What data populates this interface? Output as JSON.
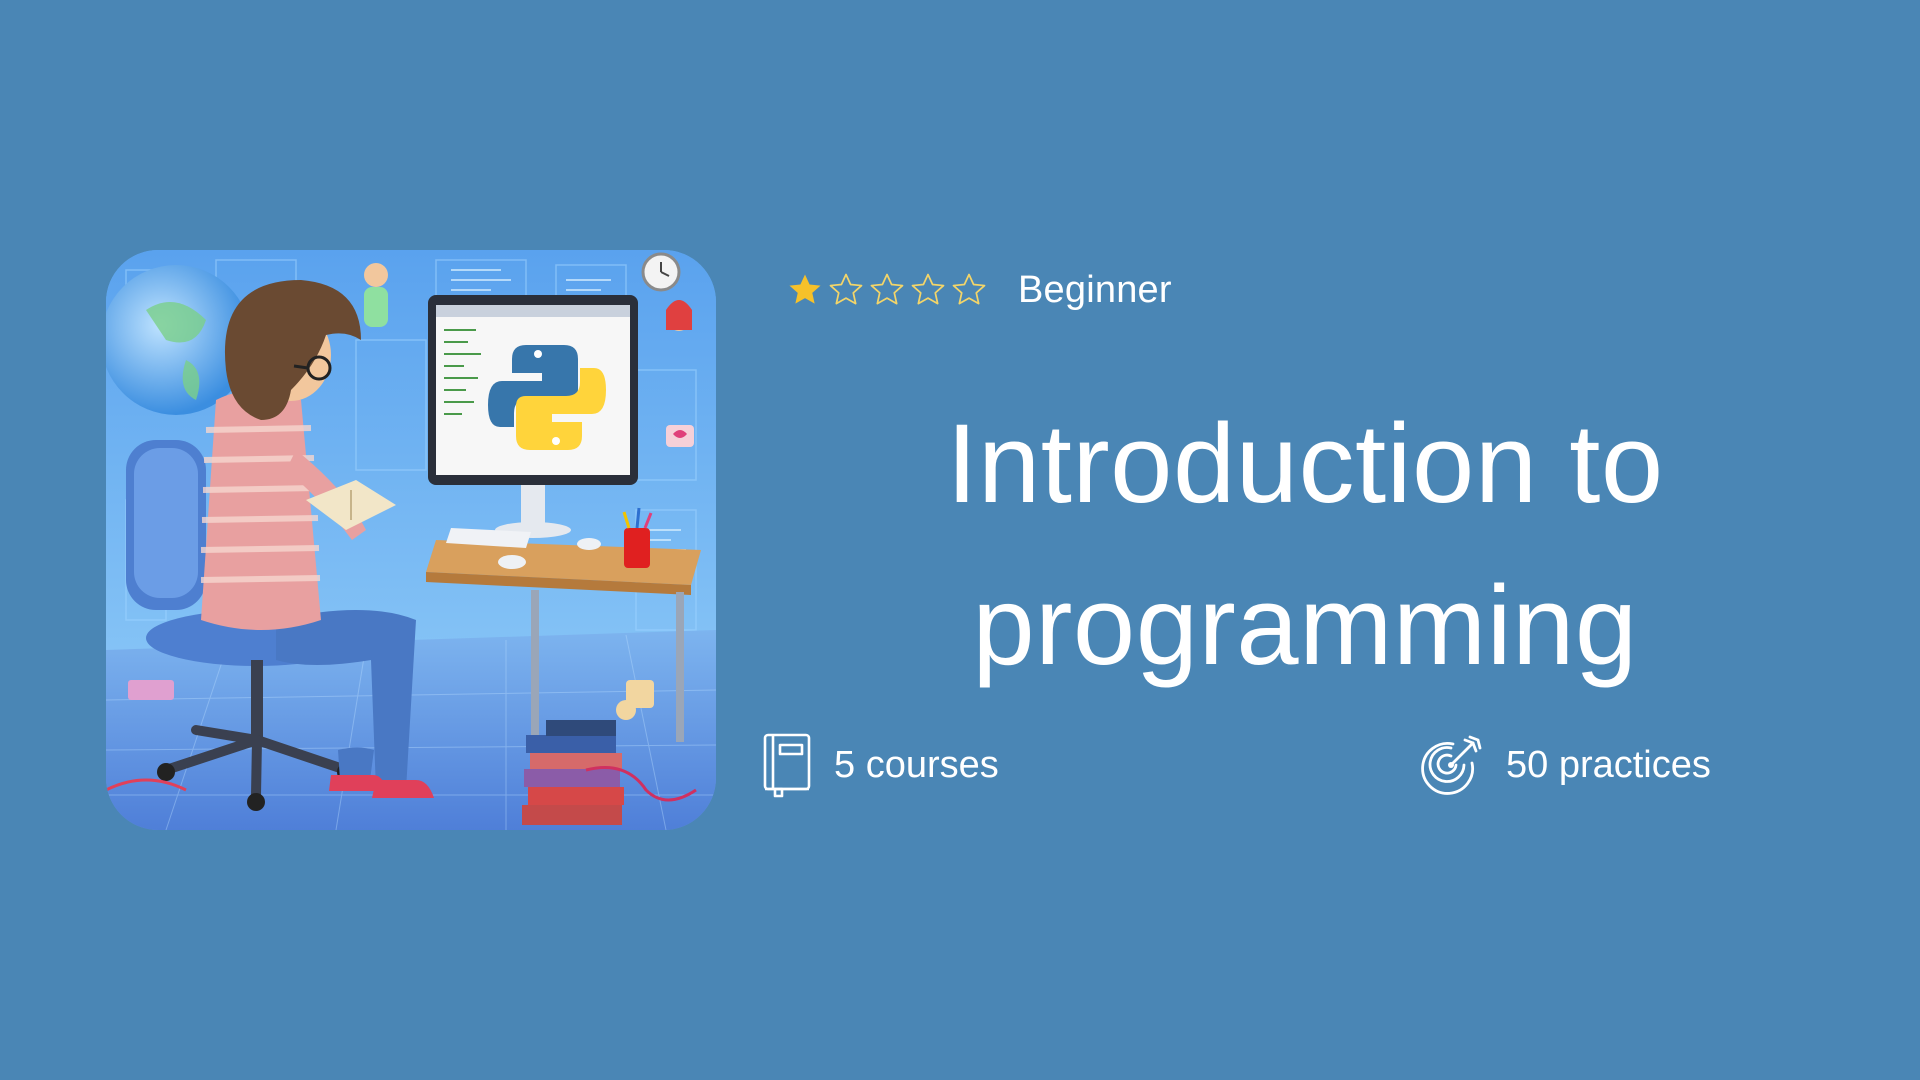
{
  "course": {
    "title": "Introduction to programming",
    "level": {
      "label": "Beginner",
      "rating_filled": 1,
      "rating_max": 5
    },
    "stats": {
      "courses_label": "5 courses",
      "practices_label": "50 practices"
    }
  },
  "illustration": {
    "subject": "person-at-computer-with-python-logo-illustration"
  },
  "icons": {
    "star_filled": "star-filled-icon",
    "star_empty": "star-outline-icon",
    "courses": "book-icon",
    "practices": "target-arrow-icon"
  },
  "colors": {
    "background": "#4a86b5",
    "text": "#ffffff",
    "star_filled": "#f6c12a",
    "star_outline": "#f3d569"
  }
}
